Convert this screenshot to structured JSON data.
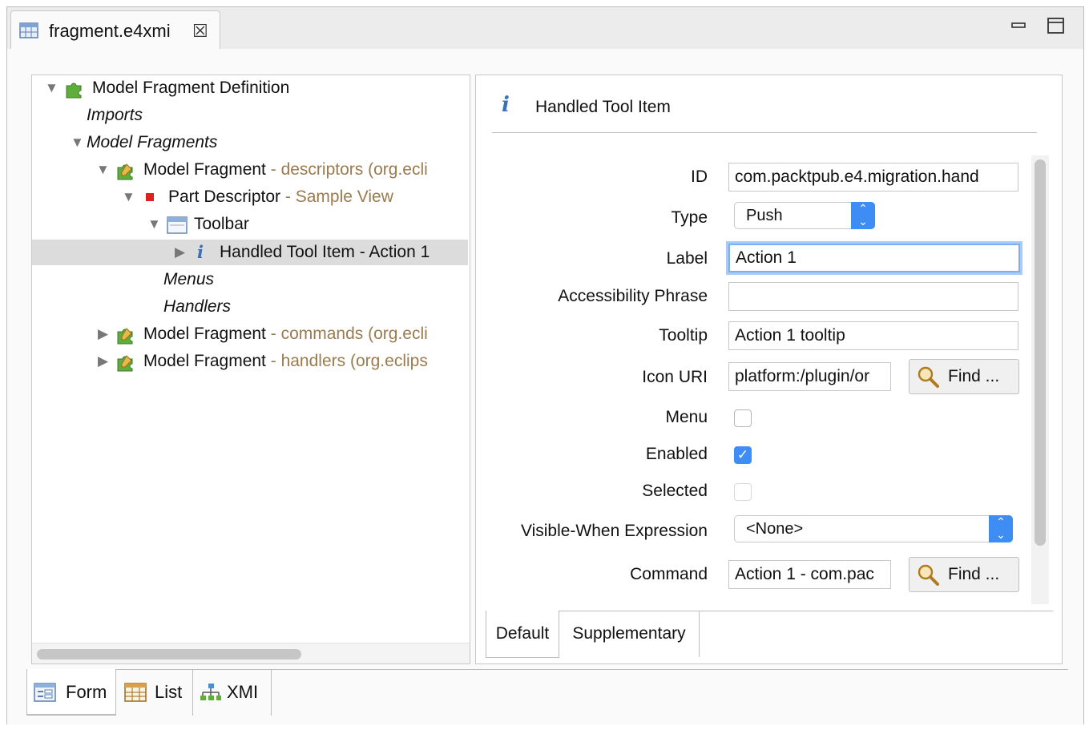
{
  "editor_tab": {
    "title": "fragment.e4xmi",
    "close_glyph": "☒"
  },
  "tree": {
    "root": {
      "label": "Model Fragment Definition",
      "icon": "puzzle-icon"
    },
    "imports": "Imports",
    "model_fragments": "Model Fragments",
    "fragment1": {
      "label": "Model Fragment",
      "sub": " - descriptors (org.ecli"
    },
    "part_descriptor": {
      "label": "Part Descriptor",
      "sub": " - Sample View"
    },
    "toolbar": "Toolbar",
    "handled_tool_item": "Handled Tool Item - Action 1",
    "menus": "Menus",
    "handlers": "Handlers",
    "fragment2": {
      "label": "Model Fragment",
      "sub": " - commands (org.ecli"
    },
    "fragment3": {
      "label": "Model Fragment",
      "sub": " - handlers (org.eclips"
    }
  },
  "detail": {
    "title": "Handled Tool Item",
    "info_glyph": "i",
    "id": {
      "label": "ID",
      "value": "com.packtpub.e4.migration.hand"
    },
    "type": {
      "label": "Type",
      "value": "Push"
    },
    "label": {
      "label": "Label",
      "value": "Action 1"
    },
    "accessibility": {
      "label": "Accessibility Phrase",
      "value": ""
    },
    "tooltip": {
      "label": "Tooltip",
      "value": "Action 1 tooltip"
    },
    "icon_uri": {
      "label": "Icon URI",
      "value": "platform:/plugin/or"
    },
    "find_label": "Find ...",
    "menu": {
      "label": "Menu",
      "checked": false
    },
    "enabled": {
      "label": "Enabled",
      "checked": true
    },
    "selected": {
      "label": "Selected",
      "checked": false
    },
    "visible_when": {
      "label": "Visible-When Expression",
      "value": "<None>"
    },
    "command": {
      "label": "Command",
      "value": "Action 1 - com.pac"
    },
    "tabs": {
      "default": "Default",
      "supplementary": "Supplementary"
    }
  },
  "bottom_tabs": {
    "form": "Form",
    "list": "List",
    "xmi": "XMI"
  },
  "colors": {
    "accent": "#3d8df5",
    "tree_sub_text": "#9a7b4f",
    "selection": "#dcdcdc"
  }
}
